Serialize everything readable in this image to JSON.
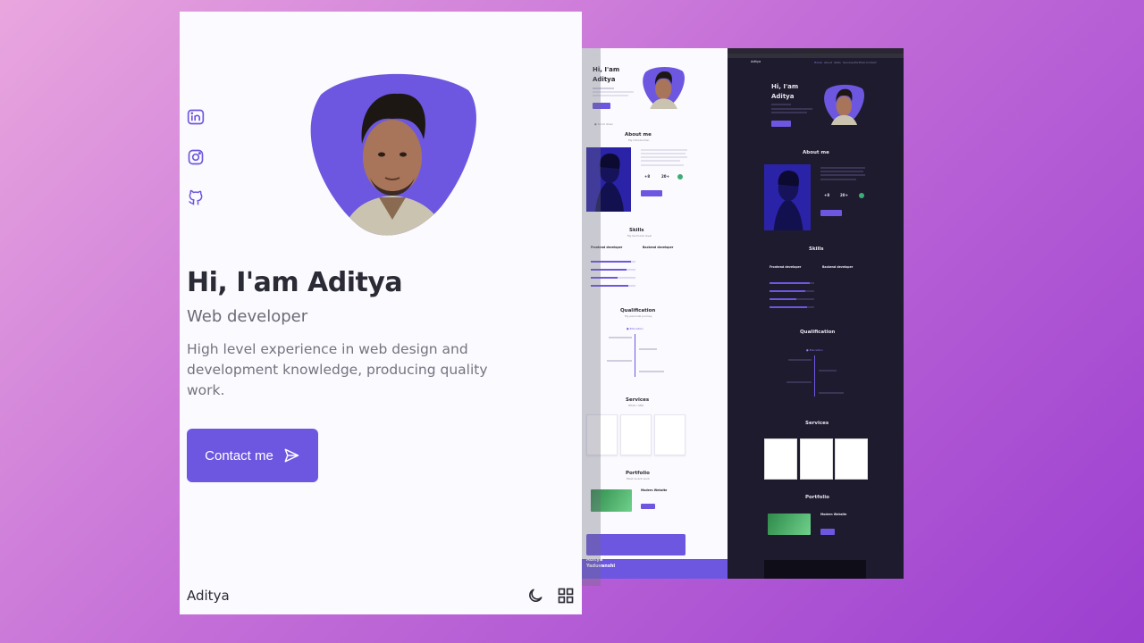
{
  "hero": {
    "greeting": "Hi, I'am Aditya",
    "role": "Web developer",
    "description": "High level experience in web design and development knowledge, producing quality work.",
    "contact_label": "Contact me"
  },
  "social_icons": [
    "linkedin-icon",
    "instagram-icon",
    "github-icon"
  ],
  "footer": {
    "name": "Aditya",
    "icons": [
      "moon-icon",
      "grid-icon"
    ]
  },
  "colors": {
    "accent": "#6e57e0",
    "dark_bg": "#1e1b2e",
    "light_bg": "#fbfafe"
  },
  "preview": {
    "greeting_line1": "Hi, I'am",
    "greeting_line2": "Aditya",
    "about_title": "About me",
    "skills_title": "Skills",
    "frontend": "Frontend developer",
    "backend": "Backend developer",
    "qualification_title": "Qualification",
    "services_title": "Services",
    "portfolio_title": "Portfolio",
    "portfolio_item": "Modern Website",
    "footer_name_1": "Aditya",
    "footer_name_2": "Yaduvanshi",
    "stats": [
      "+8",
      "20+"
    ],
    "nav_brand": "Aditya",
    "nav_items": [
      "Home",
      "About",
      "Skills",
      "Services",
      "Portfolio",
      "Contact"
    ]
  }
}
